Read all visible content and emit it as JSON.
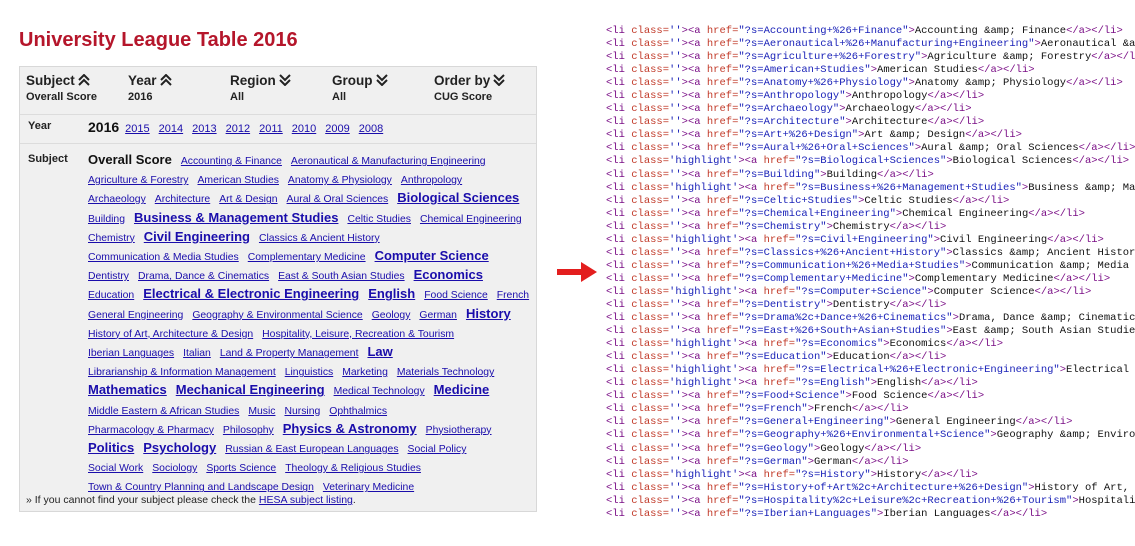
{
  "title": "University League Table 2016",
  "filters": [
    {
      "label": "Subject",
      "value": "Overall Score",
      "arrow": "up"
    },
    {
      "label": "Year",
      "value": "2016",
      "arrow": "up"
    },
    {
      "label": "Region",
      "value": "All",
      "arrow": "down"
    },
    {
      "label": "Group",
      "value": "All",
      "arrow": "down"
    },
    {
      "label": "Order by",
      "value": "CUG Score",
      "arrow": "down"
    }
  ],
  "year_row": {
    "label": "Year",
    "current": "2016",
    "links": [
      "2015",
      "2014",
      "2013",
      "2012",
      "2011",
      "2010",
      "2009",
      "2008"
    ]
  },
  "subject_label": "Subject",
  "subject_lines": [
    [
      {
        "t": "Overall Score",
        "k": "current"
      },
      {
        "t": "Accounting & Finance",
        "k": "n"
      },
      {
        "t": "Aeronautical & Manufacturing Engineering",
        "k": "n"
      }
    ],
    [
      {
        "t": "Agriculture & Forestry",
        "k": "n"
      },
      {
        "t": "American Studies",
        "k": "n"
      },
      {
        "t": "Anatomy & Physiology",
        "k": "n"
      },
      {
        "t": "Anthropology",
        "k": "n"
      }
    ],
    [
      {
        "t": "Archaeology",
        "k": "n"
      },
      {
        "t": "Architecture",
        "k": "n"
      },
      {
        "t": "Art & Design",
        "k": "n"
      },
      {
        "t": "Aural & Oral Sciences",
        "k": "n"
      },
      {
        "t": "Biological Sciences",
        "k": "h"
      }
    ],
    [
      {
        "t": "Building",
        "k": "n"
      },
      {
        "t": "Business & Management Studies",
        "k": "h"
      },
      {
        "t": "Celtic Studies",
        "k": "n"
      },
      {
        "t": "Chemical Engineering",
        "k": "n"
      }
    ],
    [
      {
        "t": "Chemistry",
        "k": "n"
      },
      {
        "t": "Civil Engineering",
        "k": "h"
      },
      {
        "t": "Classics & Ancient History",
        "k": "n"
      }
    ],
    [
      {
        "t": "Communication & Media Studies",
        "k": "n"
      },
      {
        "t": "Complementary Medicine",
        "k": "n"
      },
      {
        "t": "Computer Science",
        "k": "h"
      }
    ],
    [
      {
        "t": "Dentistry",
        "k": "n"
      },
      {
        "t": "Drama, Dance & Cinematics",
        "k": "n"
      },
      {
        "t": "East & South Asian Studies",
        "k": "n"
      },
      {
        "t": "Economics",
        "k": "h"
      }
    ],
    [
      {
        "t": "Education",
        "k": "n"
      },
      {
        "t": "Electrical & Electronic Engineering",
        "k": "h"
      },
      {
        "t": "English",
        "k": "h"
      },
      {
        "t": "Food Science",
        "k": "n"
      },
      {
        "t": "French",
        "k": "n"
      }
    ],
    [
      {
        "t": "General Engineering",
        "k": "n"
      },
      {
        "t": "Geography & Environmental Science",
        "k": "n"
      },
      {
        "t": "Geology",
        "k": "n"
      },
      {
        "t": "German",
        "k": "n"
      },
      {
        "t": "History",
        "k": "h"
      }
    ],
    [
      {
        "t": "History of Art, Architecture & Design",
        "k": "n"
      },
      {
        "t": "Hospitality, Leisure, Recreation & Tourism",
        "k": "n"
      }
    ],
    [
      {
        "t": "Iberian Languages",
        "k": "n"
      },
      {
        "t": "Italian",
        "k": "n"
      },
      {
        "t": "Land & Property Management",
        "k": "n"
      },
      {
        "t": "Law",
        "k": "h"
      }
    ],
    [
      {
        "t": "Librarianship & Information Management",
        "k": "n"
      },
      {
        "t": "Linguistics",
        "k": "n"
      },
      {
        "t": "Marketing",
        "k": "n"
      },
      {
        "t": "Materials Technology",
        "k": "n"
      }
    ],
    [
      {
        "t": "Mathematics",
        "k": "h"
      },
      {
        "t": "Mechanical Engineering",
        "k": "h"
      },
      {
        "t": "Medical Technology",
        "k": "n"
      },
      {
        "t": "Medicine",
        "k": "h"
      }
    ],
    [
      {
        "t": "Middle Eastern & African Studies",
        "k": "n"
      },
      {
        "t": "Music",
        "k": "n"
      },
      {
        "t": "Nursing",
        "k": "n"
      },
      {
        "t": "Ophthalmics",
        "k": "n"
      }
    ],
    [
      {
        "t": "Pharmacology & Pharmacy",
        "k": "n"
      },
      {
        "t": "Philosophy",
        "k": "n"
      },
      {
        "t": "Physics & Astronomy",
        "k": "h"
      },
      {
        "t": "Physiotherapy",
        "k": "n"
      }
    ],
    [
      {
        "t": "Politics",
        "k": "h"
      },
      {
        "t": "Psychology",
        "k": "h"
      },
      {
        "t": "Russian & East European Languages",
        "k": "n"
      },
      {
        "t": "Social Policy",
        "k": "n"
      }
    ],
    [
      {
        "t": "Social Work",
        "k": "n"
      },
      {
        "t": "Sociology",
        "k": "n"
      },
      {
        "t": "Sports Science",
        "k": "n"
      },
      {
        "t": "Theology & Religious Studies",
        "k": "n"
      }
    ],
    [
      {
        "t": "Town & Country Planning and Landscape Design",
        "k": "n"
      },
      {
        "t": "Veterinary Medicine",
        "k": "n"
      }
    ]
  ],
  "note": {
    "prefix": "» If you cannot find your subject please check the ",
    "link": "HESA subject listing",
    "suffix": "."
  },
  "code_lines": [
    {
      "c": "",
      "h": "?s=Accounting+%26+Finance",
      "t": "Accounting &amp; Finance"
    },
    {
      "c": "",
      "h": "?s=Aeronautical+%26+Manufacturing+Engineering",
      "t": "Aeronautical &amp; Manufacturing Engineering"
    },
    {
      "c": "",
      "h": "?s=Agriculture+%26+Forestry",
      "t": "Agriculture &amp; Forestry"
    },
    {
      "c": "",
      "h": "?s=American+Studies",
      "t": "American Studies"
    },
    {
      "c": "",
      "h": "?s=Anatomy+%26+Physiology",
      "t": "Anatomy &amp; Physiology"
    },
    {
      "c": "",
      "h": "?s=Anthropology",
      "t": "Anthropology"
    },
    {
      "c": "",
      "h": "?s=Archaeology",
      "t": "Archaeology"
    },
    {
      "c": "",
      "h": "?s=Architecture",
      "t": "Architecture"
    },
    {
      "c": "",
      "h": "?s=Art+%26+Design",
      "t": "Art &amp; Design"
    },
    {
      "c": "",
      "h": "?s=Aural+%26+Oral+Sciences",
      "t": "Aural &amp; Oral Sciences"
    },
    {
      "c": "highlight",
      "h": "?s=Biological+Sciences",
      "t": "Biological Sciences"
    },
    {
      "c": "",
      "h": "?s=Building",
      "t": "Building"
    },
    {
      "c": "highlight",
      "h": "?s=Business+%26+Management+Studies",
      "t": "Business &amp; Management Studies"
    },
    {
      "c": "",
      "h": "?s=Celtic+Studies",
      "t": "Celtic Studies"
    },
    {
      "c": "",
      "h": "?s=Chemical+Engineering",
      "t": "Chemical Engineering"
    },
    {
      "c": "",
      "h": "?s=Chemistry",
      "t": "Chemistry"
    },
    {
      "c": "highlight",
      "h": "?s=Civil+Engineering",
      "t": "Civil Engineering"
    },
    {
      "c": "",
      "h": "?s=Classics+%26+Ancient+History",
      "t": "Classics &amp; Ancient History"
    },
    {
      "c": "",
      "h": "?s=Communication+%26+Media+Studies",
      "t": "Communication &amp; Media Studies"
    },
    {
      "c": "",
      "h": "?s=Complementary+Medicine",
      "t": "Complementary Medicine"
    },
    {
      "c": "highlight",
      "h": "?s=Computer+Science",
      "t": "Computer Science"
    },
    {
      "c": "",
      "h": "?s=Dentistry",
      "t": "Dentistry"
    },
    {
      "c": "",
      "h": "?s=Drama%2c+Dance+%26+Cinematics",
      "t": "Drama, Dance &amp; Cinematics"
    },
    {
      "c": "",
      "h": "?s=East+%26+South+Asian+Studies",
      "t": "East &amp; South Asian Studies"
    },
    {
      "c": "highlight",
      "h": "?s=Economics",
      "t": "Economics"
    },
    {
      "c": "",
      "h": "?s=Education",
      "t": "Education"
    },
    {
      "c": "highlight",
      "h": "?s=Electrical+%26+Electronic+Engineering",
      "t": "Electrical &amp; Electronic Engineering"
    },
    {
      "c": "highlight",
      "h": "?s=English",
      "t": "English"
    },
    {
      "c": "",
      "h": "?s=Food+Science",
      "t": "Food Science"
    },
    {
      "c": "",
      "h": "?s=French",
      "t": "French"
    },
    {
      "c": "",
      "h": "?s=General+Engineering",
      "t": "General Engineering"
    },
    {
      "c": "",
      "h": "?s=Geography+%26+Environmental+Science",
      "t": "Geography &amp; Environmental Science"
    },
    {
      "c": "",
      "h": "?s=Geology",
      "t": "Geology"
    },
    {
      "c": "",
      "h": "?s=German",
      "t": "German"
    },
    {
      "c": "highlight",
      "h": "?s=History",
      "t": "History"
    },
    {
      "c": "",
      "h": "?s=History+of+Art%2c+Architecture+%26+Design",
      "t": "History of Art, Architecture &amp; Design"
    },
    {
      "c": "",
      "h": "?s=Hospitality%2c+Leisure%2c+Recreation+%26+Tourism",
      "t": "Hospitality, Leisure, Recreation &amp; Tourism"
    },
    {
      "c": "",
      "h": "?s=Iberian+Languages",
      "t": "Iberian Languages"
    }
  ],
  "colors": {
    "title": "#b5162b",
    "link": "#1a0dab",
    "panel_bg": "#f0f0f0",
    "arrow": "#e31e1e",
    "tag": "#7a0e86",
    "attr": "#c23b2a",
    "value": "#1a22b8"
  }
}
